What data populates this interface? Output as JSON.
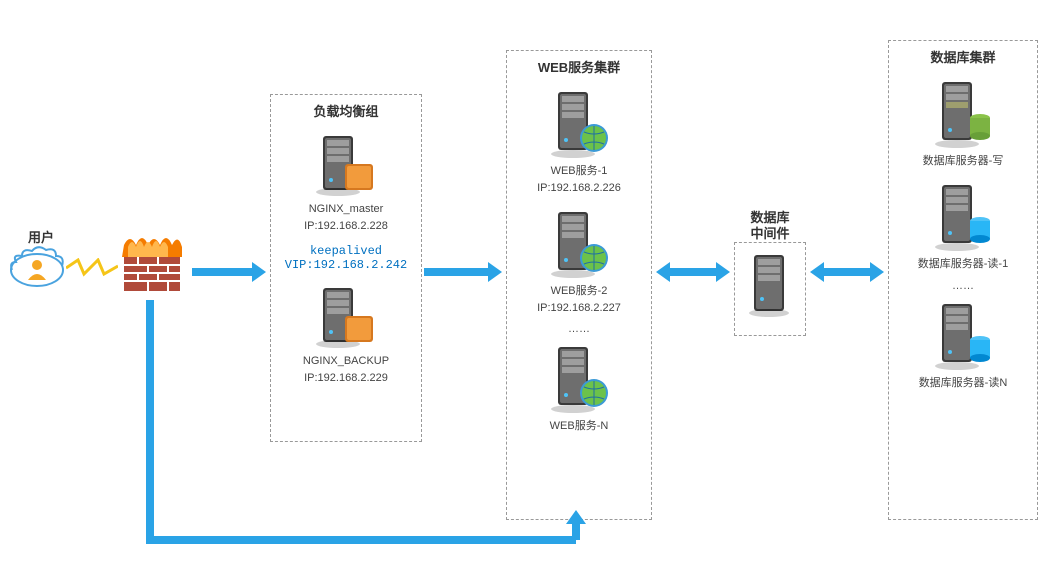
{
  "user": {
    "label": "用户"
  },
  "lb_group": {
    "title": "负载均衡组",
    "master": {
      "name": "NGINX_master",
      "ip": "IP:192.168.2.228"
    },
    "keepalived": {
      "label": "keepalived",
      "vip": "VIP:192.168.2.242"
    },
    "backup": {
      "name": "NGINX_BACKUP",
      "ip": "IP:192.168.2.229"
    }
  },
  "web_cluster": {
    "title": "WEB服务集群",
    "nodes": [
      {
        "name": "WEB服务-1",
        "ip": "IP:192.168.2.226"
      },
      {
        "name": "WEB服务-2",
        "ip": "IP:192.168.2.227"
      },
      {
        "name": "WEB服务-N",
        "ip": ""
      }
    ],
    "ellipsis": "……"
  },
  "db_middleware": {
    "title": "数据库\n中间件"
  },
  "db_cluster": {
    "title": "数据库集群",
    "nodes": [
      {
        "name": "数据库服务器-写"
      },
      {
        "name": "数据库服务器-读-1"
      },
      {
        "name": "数据库服务器-读N"
      }
    ],
    "ellipsis": "……"
  }
}
